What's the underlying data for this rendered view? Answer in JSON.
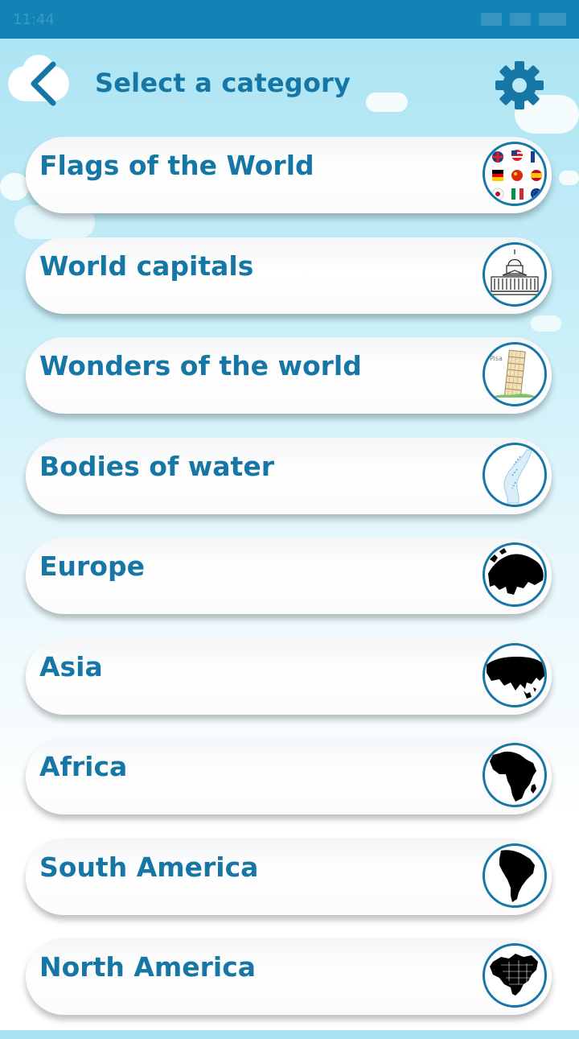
{
  "status_bar": {
    "time": "11:44"
  },
  "header": {
    "title": "Select a category",
    "back_icon": "chevron-left-icon",
    "settings_icon": "gear-icon"
  },
  "colors": {
    "accent": "#1677a6",
    "status_bar": "#1283b5",
    "sky": "#a9e3f2"
  },
  "categories": [
    {
      "label": "Flags of the World",
      "icon": "flags-icon"
    },
    {
      "label": "World capitals",
      "icon": "capitol-building-icon"
    },
    {
      "label": "Wonders of the world",
      "icon": "leaning-tower-icon"
    },
    {
      "label": "Bodies of water",
      "icon": "water-icon"
    },
    {
      "label": "Europe",
      "icon": "europe-map-icon"
    },
    {
      "label": "Asia",
      "icon": "asia-map-icon"
    },
    {
      "label": "Africa",
      "icon": "africa-map-icon"
    },
    {
      "label": "South America",
      "icon": "south-america-map-icon"
    },
    {
      "label": "North America",
      "icon": "north-america-map-icon"
    }
  ]
}
